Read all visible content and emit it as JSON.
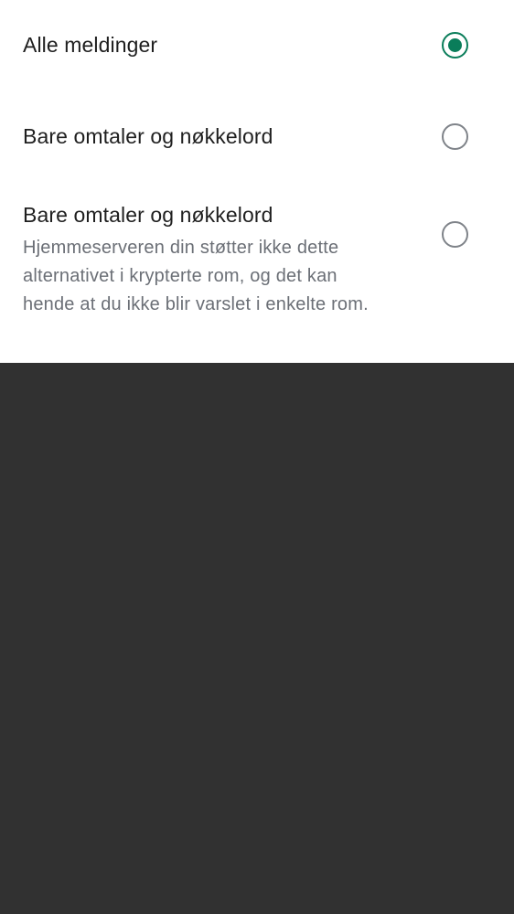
{
  "options": [
    {
      "title": "Alle meldinger",
      "description": "",
      "selected": true
    },
    {
      "title": "Bare omtaler og nøkkelord",
      "description": "",
      "selected": false
    },
    {
      "title": "Bare omtaler og nøkkelord",
      "description": "Hjemmeserveren din støtter ikke dette alternativet i krypterte rom, og det kan hende at du ikke blir varslet i enkelte rom.",
      "selected": false
    }
  ],
  "colors": {
    "accent": "#0a7d5a",
    "radio_unselected": "#7f8389",
    "title_text": "#1f1f1f",
    "description_text": "#6b6f76",
    "scrim": "#313131"
  }
}
